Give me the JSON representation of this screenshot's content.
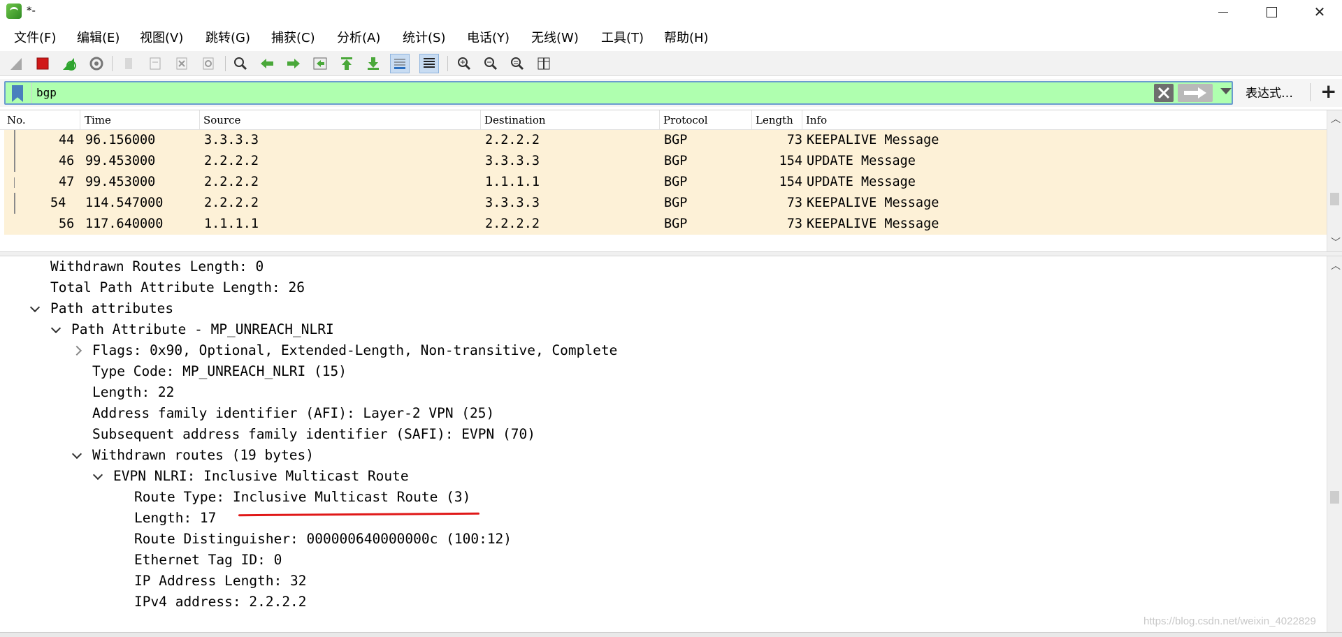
{
  "window": {
    "title": "*-",
    "minimize_icon": "minimize-icon",
    "maximize_icon": "maximize-icon",
    "close_icon": "close-icon",
    "close_symbol": "✕"
  },
  "menu": [
    {
      "label": "文件(F)"
    },
    {
      "label": "编辑(E)"
    },
    {
      "label": "视图(V)"
    },
    {
      "label": "跳转(G)"
    },
    {
      "label": "捕获(C)"
    },
    {
      "label": "分析(A)"
    },
    {
      "label": "统计(S)"
    },
    {
      "label": "电话(Y)"
    },
    {
      "label": "无线(W)"
    },
    {
      "label": "工具(T)"
    },
    {
      "label": "帮助(H)"
    }
  ],
  "toolbar": {
    "icons": [
      "shark-fin-start-icon",
      "stop-capture-icon",
      "restart-capture-icon",
      "capture-options-icon",
      "open-file-icon",
      "save-file-icon",
      "close-file-icon",
      "reload-file-icon",
      "find-packet-icon",
      "go-back-icon",
      "go-forward-icon",
      "go-to-packet-icon",
      "first-packet-icon",
      "last-packet-icon",
      "auto-scroll-icon",
      "colorize-icon",
      "zoom-in-icon",
      "zoom-out-icon",
      "normal-size-icon",
      "resize-columns-icon"
    ],
    "colors": {
      "stop": "#d01818",
      "restart": "#2fa52f",
      "arrow": "#4aa83a",
      "zoom": "#3a3a3a"
    }
  },
  "filter": {
    "value": "bgp",
    "background": "#afffaf",
    "expression_label": "表达式…",
    "plus_label": "+"
  },
  "packet_list": {
    "columns": [
      "No.",
      "Time",
      "Source",
      "Destination",
      "Protocol",
      "Length",
      "Info"
    ],
    "rows": [
      {
        "no": "44",
        "time": "96.156000",
        "source": "3.3.3.3",
        "destination": "2.2.2.2",
        "protocol": "BGP",
        "length": "73",
        "info": "KEEPALIVE Message"
      },
      {
        "no": "46",
        "time": "99.453000",
        "source": "2.2.2.2",
        "destination": "3.3.3.3",
        "protocol": "BGP",
        "length": "154",
        "info": "UPDATE Message"
      },
      {
        "no": "47",
        "time": "99.453000",
        "source": "2.2.2.2",
        "destination": "1.1.1.1",
        "protocol": "BGP",
        "length": "154",
        "info": "UPDATE Message"
      },
      {
        "no": "54",
        "time": "114.547000",
        "source": "2.2.2.2",
        "destination": "3.3.3.3",
        "protocol": "BGP",
        "length": "73",
        "info": "KEEPALIVE Message"
      },
      {
        "no": "56",
        "time": "117.640000",
        "source": "1.1.1.1",
        "destination": "2.2.2.2",
        "protocol": "BGP",
        "length": "73",
        "info": "KEEPALIVE Message"
      }
    ],
    "row_color": "#fdf1d7"
  },
  "details": {
    "lines": [
      {
        "text": "Withdrawn Routes Length: 0",
        "caret": "none"
      },
      {
        "text": "Total Path Attribute Length: 26",
        "caret": "none"
      },
      {
        "text": "Path attributes",
        "caret": "down"
      },
      {
        "text": "Path Attribute - MP_UNREACH_NLRI",
        "caret": "down"
      },
      {
        "text": "Flags: 0x90, Optional, Extended-Length, Non-transitive, Complete",
        "caret": "right"
      },
      {
        "text": "Type Code: MP_UNREACH_NLRI (15)",
        "caret": "none"
      },
      {
        "text": "Length: 22",
        "caret": "none"
      },
      {
        "text": "Address family identifier (AFI): Layer-2 VPN (25)",
        "caret": "none"
      },
      {
        "text": "Subsequent address family identifier (SAFI): EVPN (70)",
        "caret": "none"
      },
      {
        "text": "Withdrawn routes (19 bytes)",
        "caret": "down"
      },
      {
        "text": "EVPN NLRI: Inclusive Multicast Route",
        "caret": "down"
      },
      {
        "text": "Route Type: Inclusive Multicast Route (3)",
        "caret": "none"
      },
      {
        "text": "Length: 17",
        "caret": "none"
      },
      {
        "text": "Route Distinguisher: 000000640000000c (100:12)",
        "caret": "none"
      },
      {
        "text": "Ethernet Tag ID: 0",
        "caret": "none"
      },
      {
        "text": "IP Address Length: 32",
        "caret": "none"
      },
      {
        "text": "IPv4 address: 2.2.2.2",
        "caret": "none"
      }
    ],
    "highlight_color": "#e01818"
  },
  "watermark": "https://blog.csdn.net/weixin_4022829"
}
